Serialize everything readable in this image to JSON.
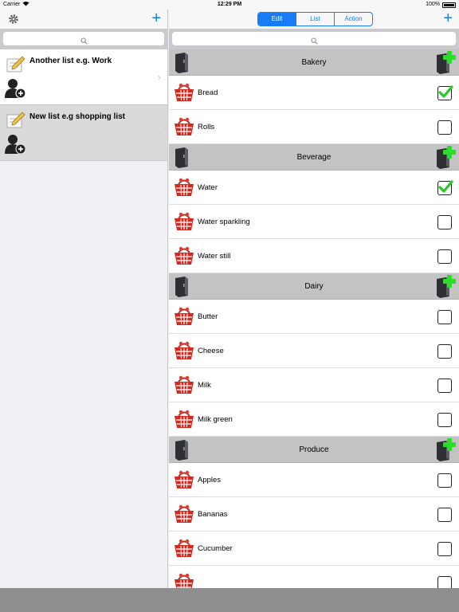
{
  "status": {
    "carrier": "Carrier",
    "time": "12:29 PM",
    "battery": "100%"
  },
  "left": {
    "lists": [
      {
        "title": "Another list e.g. Work"
      },
      {
        "title": "New list e.g shopping list"
      }
    ]
  },
  "right": {
    "segments": [
      {
        "label": "Edit",
        "selected": true
      },
      {
        "label": "List",
        "selected": false
      },
      {
        "label": "Action",
        "selected": false
      }
    ],
    "sections": [
      {
        "name": "Bakery",
        "items": [
          {
            "name": "Bread",
            "checked": true
          },
          {
            "name": "Rolls",
            "checked": false
          }
        ]
      },
      {
        "name": "Beverage",
        "items": [
          {
            "name": "Water",
            "checked": true
          },
          {
            "name": "Water sparkling",
            "checked": false
          },
          {
            "name": "Water still",
            "checked": false
          }
        ]
      },
      {
        "name": "Dairy",
        "items": [
          {
            "name": "Butter",
            "checked": false
          },
          {
            "name": "Cheese",
            "checked": false
          },
          {
            "name": "Milk",
            "checked": false
          },
          {
            "name": "Milk green",
            "checked": false
          }
        ]
      },
      {
        "name": "Produce",
        "items": [
          {
            "name": "Apples",
            "checked": false
          },
          {
            "name": "Bananas",
            "checked": false
          },
          {
            "name": "Cucumber",
            "checked": false
          },
          {
            "name": "",
            "checked": false
          }
        ]
      }
    ]
  },
  "colors": {
    "accent": "#1a7cf5",
    "check": "#22cc22",
    "basket": "#d42a1e",
    "section_bg": "#c3c3c3"
  },
  "icons": {
    "settings": "gear-icon",
    "add": "plus-icon",
    "search": "search-icon",
    "list": "notepad-icon",
    "share": "add-person-icon",
    "item": "basket-icon",
    "category": "cabinet-icon",
    "add_category": "cabinet-add-icon"
  }
}
